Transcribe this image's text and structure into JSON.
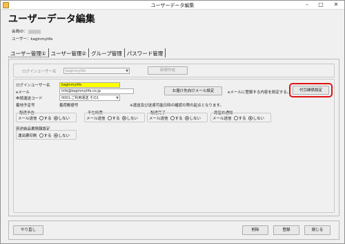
{
  "window": {
    "title": "ユーザーデータ編集",
    "minimize": "–",
    "maximize": "□",
    "close": "✕"
  },
  "header": {
    "page_title": "ユーザーデータ編集",
    "member_id_label": "会員ID：",
    "user_line": "ユーザー：kaginmylife"
  },
  "tabs": [
    "ユーザー管理①",
    "ユーザー管理②",
    "グループ管理",
    "パスワード管理"
  ],
  "login_group": {
    "login_user_label": "ログインユーザー名",
    "login_user_value": "kaginmylife",
    "new_button": "新規作成"
  },
  "form": {
    "login_name_label": "ログインユーザー名",
    "login_name_value": "kaginmylife",
    "email_label": "eメール",
    "email_value": "info@kaginmylife.co.jp",
    "plan_label": "申請運送コード",
    "plan_value": "0001:ご利用運送 その1",
    "notify_button": "お届け先向けメール設定",
    "email_note": "eメールに登録する内容を設定する。",
    "proxy_button": "代引関係設定",
    "shipment_note": "※運送及び送達可能日時の確認の際の起点となります。",
    "schedule_label": "着地予定号",
    "schedule_value": "着荷郵便号"
  },
  "radio_groups": {
    "arrival_notice": {
      "title": "配達予告",
      "label": "メール送信",
      "yes": "する",
      "no": "しない"
    },
    "absent": {
      "title": "不在時票",
      "label": "メール送信",
      "yes": "する",
      "no": "しない"
    },
    "delivered": {
      "title": "配達完了",
      "label": "メール送信",
      "yes": "する",
      "no": "しない"
    },
    "pickup": {
      "title": "局留め通知",
      "label": "メール送信",
      "yes": "する",
      "no": "しない"
    },
    "invoice": {
      "title": "別途納品書情報設定",
      "label": "運出票印刷",
      "yes": "する",
      "no": "しない"
    }
  },
  "footer": {
    "redo_button": "やり直し",
    "delete_button": "削除",
    "register_button": "登録",
    "close_button": "閉じる"
  }
}
